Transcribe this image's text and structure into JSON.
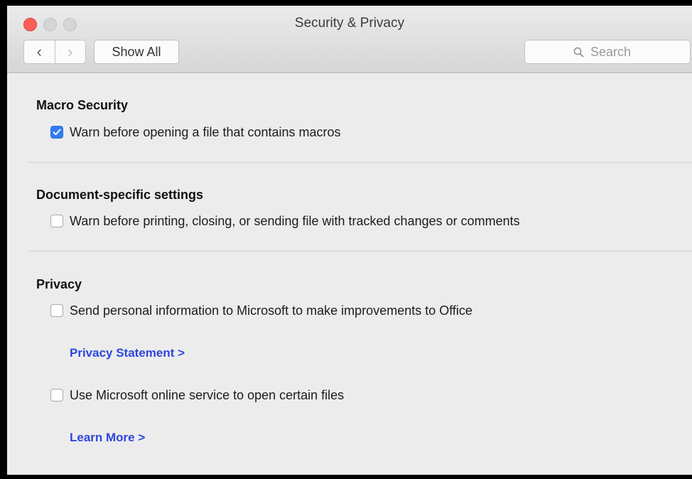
{
  "window": {
    "title": "Security & Privacy",
    "nav": {
      "back_icon": "‹",
      "forward_icon": "›"
    },
    "show_all_label": "Show All",
    "search": {
      "placeholder": "Search"
    }
  },
  "colors": {
    "close_button": "#fc5f57",
    "checkbox_checked": "#2f7cf6",
    "link": "#2f46dd"
  },
  "sections": {
    "macro": {
      "title": "Macro Security",
      "options": [
        {
          "label": "Warn before opening a file that contains macros",
          "checked": true
        }
      ]
    },
    "document": {
      "title": "Document-specific settings",
      "options": [
        {
          "label": "Warn before printing, closing, or sending file with tracked changes or comments",
          "checked": false
        }
      ]
    },
    "privacy": {
      "title": "Privacy",
      "options": [
        {
          "label": "Send personal information to Microsoft to make improvements to Office",
          "checked": false
        },
        {
          "label": "Use Microsoft online service to open certain files",
          "checked": false
        }
      ],
      "links": [
        "Privacy Statement >",
        "Learn More >"
      ]
    }
  }
}
